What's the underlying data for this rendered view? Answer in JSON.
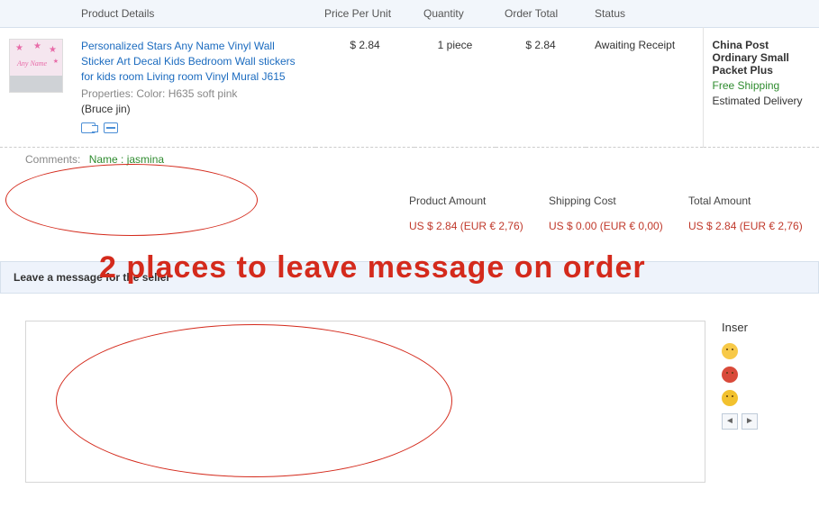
{
  "headers": {
    "product_details": "Product Details",
    "price_per_unit": "Price Per Unit",
    "quantity": "Quantity",
    "order_total": "Order Total",
    "status": "Status"
  },
  "item": {
    "title": "Personalized Stars Any Name Vinyl Wall Sticker Art Decal Kids Bedroom Wall stickers for kids room Living room Vinyl Mural J615",
    "properties": "Properties: Color: H635 soft pink",
    "seller": "(Bruce jin)",
    "price": "$ 2.84",
    "qty": "1 piece",
    "total": "$ 2.84",
    "status": "Awaiting Receipt"
  },
  "shipping": {
    "method": "China Post Ordinary Small Packet Plus",
    "free": "Free Shipping",
    "estimated": "Estimated Delivery"
  },
  "comments": {
    "label": "Comments:",
    "value": "Name : jasmina"
  },
  "totals": {
    "headers": {
      "product_amount": "Product Amount",
      "shipping_cost": "Shipping Cost",
      "total_amount": "Total Amount"
    },
    "values": {
      "product_amount": "US $ 2.84 (EUR € 2,76)",
      "shipping_cost": "US $ 0.00 (EUR € 0,00)",
      "total_amount": "US $ 2.84 (EUR € 2,76)"
    }
  },
  "message_section": {
    "title": "Leave a message for the seller",
    "placeholder": ""
  },
  "emoji": {
    "title": "Inser",
    "prev": "◄",
    "next": "►"
  },
  "annotation": {
    "text": "2 places to leave message on order"
  }
}
